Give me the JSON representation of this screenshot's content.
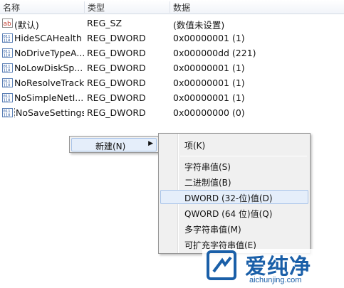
{
  "columns": {
    "name": "名称",
    "type": "类型",
    "data": "数据"
  },
  "rows": [
    {
      "icon": "string-value-icon",
      "name": "(默认)",
      "type": "REG_SZ",
      "data": "(数值未设置)"
    },
    {
      "icon": "dword-value-icon",
      "name": "HideSCAHealth",
      "type": "REG_DWORD",
      "data": "0x00000001 (1)"
    },
    {
      "icon": "dword-value-icon",
      "name": "NoDriveTypeA...",
      "type": "REG_DWORD",
      "data": "0x000000dd (221)"
    },
    {
      "icon": "dword-value-icon",
      "name": "NoLowDiskSp...",
      "type": "REG_DWORD",
      "data": "0x00000001 (1)"
    },
    {
      "icon": "dword-value-icon",
      "name": "NoResolveTrack",
      "type": "REG_DWORD",
      "data": "0x00000001 (1)"
    },
    {
      "icon": "dword-value-icon",
      "name": "NoSimpleNetI...",
      "type": "REG_DWORD",
      "data": "0x00000001 (1)"
    },
    {
      "icon": "dword-value-icon",
      "name": "NoSaveSettings",
      "type": "REG_DWORD",
      "data": "0x00000000 (0)"
    }
  ],
  "context_menu": {
    "new_label": "新建(N)",
    "arrow": "▶"
  },
  "submenu": {
    "key_label": "项(K)",
    "items": [
      "字符串值(S)",
      "二进制值(B)",
      "DWORD (32-位)值(D)",
      "QWORD (64 位)值(Q)",
      "多字符串值(M)",
      "可扩充字符串值(E)"
    ],
    "highlighted_index": 2
  },
  "watermark": {
    "cn": "爱纯净",
    "url": "aichunjing.com"
  },
  "colors": {
    "accent": "#1a5fa8",
    "menu_bg": "#f0f0f0",
    "highlight": "#e5eefa"
  }
}
